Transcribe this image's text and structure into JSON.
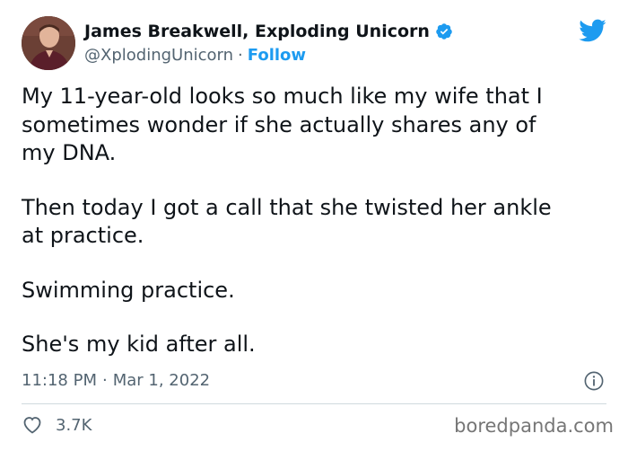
{
  "author": {
    "display_name": "James Breakwell, Exploding Unicorn",
    "handle": "@XplodingUnicorn",
    "separator": "·",
    "follow_label": "Follow",
    "verified_icon": "verified-badge-icon",
    "avatar": "author-avatar"
  },
  "tweet": {
    "paragraphs": [
      "My 11-year-old looks so much like my wife that I sometimes wonder if she actually shares any of my DNA.",
      "Then today I got a call that she twisted her ankle at practice.",
      "Swimming practice.",
      "She's my kid after all."
    ],
    "time": "11:18 PM",
    "separator": "·",
    "date": "Mar 1, 2022"
  },
  "engagement": {
    "like_count": "3.7K",
    "like_icon": "heart-icon"
  },
  "watermark": "boredpanda.com",
  "colors": {
    "text": "#0f1419",
    "secondary": "#536471",
    "accent": "#1d9bf0",
    "divider": "#cfd9de",
    "watermark": "#767676"
  }
}
